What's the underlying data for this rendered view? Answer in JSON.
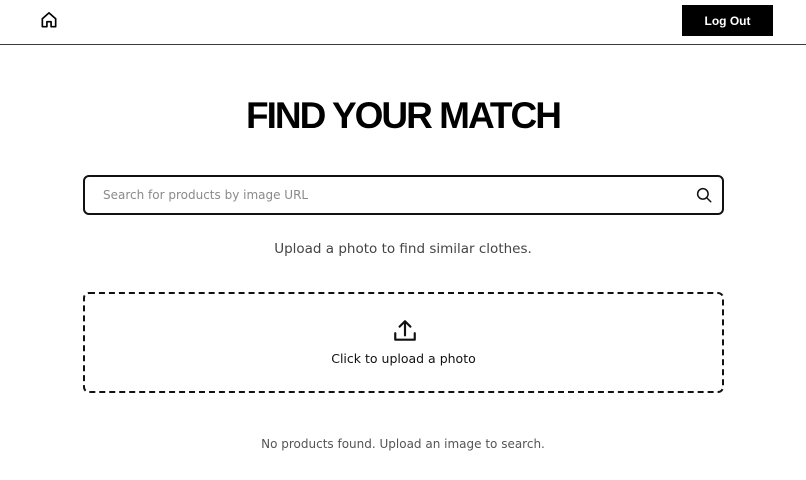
{
  "header": {
    "home_icon": "home-icon",
    "logout_label": "Log Out"
  },
  "main": {
    "title": "FIND YOUR MATCH",
    "search": {
      "placeholder": "Search for products by image URL",
      "value": "",
      "icon": "search-icon"
    },
    "subtitle": "Upload a photo to find similar clothes.",
    "upload": {
      "icon": "upload-icon",
      "label": "Click to upload a photo"
    },
    "empty_message": "No products found. Upload an image to search."
  },
  "colors": {
    "primary": "#000000",
    "background": "#ffffff",
    "muted_text": "#555555"
  }
}
